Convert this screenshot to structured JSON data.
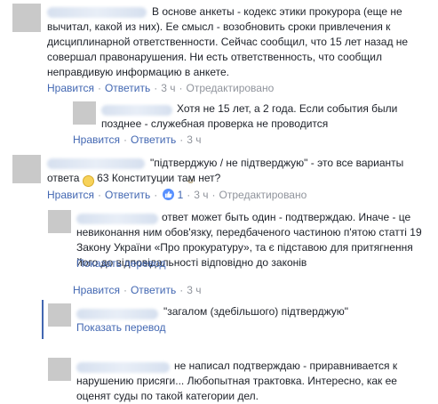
{
  "actions": {
    "like": "Нравится",
    "reply": "Ответить",
    "edited": "Отредактировано",
    "see_translation": "Показать перевод"
  },
  "comments": [
    {
      "text": "В основе анкеты - кодекс этики прокурора (еще не вычитал, какой из них). Ее смысл - возобновить сроки привлечения к дисциплинарной ответственности. Сейчас сообщил, что 15 лет назад не совершал правонарушения. Ни есть ответственность, что сообщил неправдивую информацию в анкете.",
      "time": "3 ч"
    },
    {
      "text": "Хотя не 15 лет, а 2 года. Если события были позднее - служебная проверка не проводится",
      "time": "3 ч"
    },
    {
      "text_before": "\"підтверджую / не підтверджую\" - это все варианты ответа",
      "text_after": "63 Конституции там нет?",
      "time": "3 ч",
      "like_count": "1"
    },
    {
      "text": "ответ может быть один - подтверждаю. Иначе - це невиконання ним обов'язку, передбаченого частиною п'ятою статті 19 Закону України «Про прокуратуру», та є підставою для притягнення його до відповідальності відповідно до законів",
      "time": "3 ч"
    },
    {
      "text": "\"загалом (здебільшого) підтверджую\""
    },
    {
      "text": "не написал подтверждаю - приравнивается к нарушению присяги... Любопытная трактовка. Интересно, как ее оценят суды по такой категории дел."
    }
  ]
}
